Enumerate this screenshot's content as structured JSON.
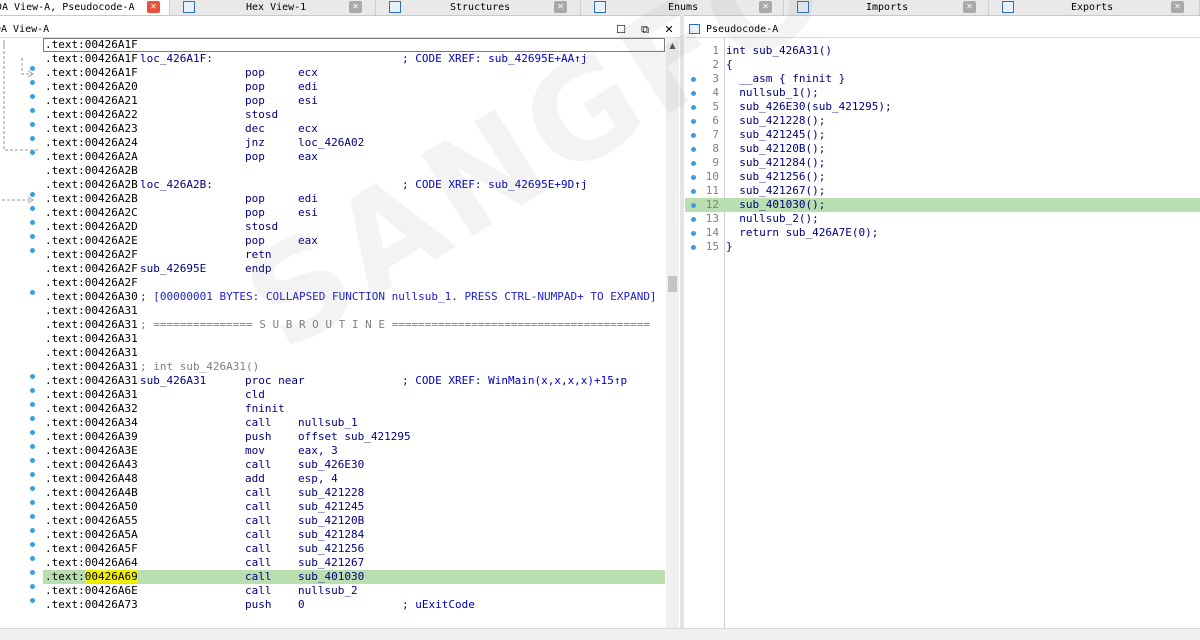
{
  "tabs": [
    {
      "label": "DA View-A, Pseudocode-A",
      "icon": "disasm-icon",
      "active": true
    },
    {
      "label": "Hex View-1",
      "icon": "hex-icon"
    },
    {
      "label": "Structures",
      "icon": "structures-icon"
    },
    {
      "label": "Enums",
      "icon": "enums-icon"
    },
    {
      "label": "Imports",
      "icon": "imports-icon"
    },
    {
      "label": "Exports",
      "icon": "exports-icon"
    }
  ],
  "left_pane": {
    "title": "DA View-A",
    "lines": [
      {
        "addr": "00426A1F"
      },
      {
        "addr": "00426A1F",
        "label": "loc_426A1F:",
        "comment": "; CODE XREF: sub_42695E+AA↑j"
      },
      {
        "addr": "00426A1F",
        "mn": "pop",
        "op": "ecx",
        "dot": true
      },
      {
        "addr": "00426A20",
        "mn": "pop",
        "op": "edi",
        "dot": true
      },
      {
        "addr": "00426A21",
        "mn": "pop",
        "op": "esi",
        "dot": true
      },
      {
        "addr": "00426A22",
        "mn": "stosd",
        "dot": true
      },
      {
        "addr": "00426A23",
        "mn": "dec",
        "op": "ecx",
        "dot": true
      },
      {
        "addr": "00426A24",
        "mn": "jnz",
        "op": "loc_426A02",
        "dot": true
      },
      {
        "addr": "00426A2A",
        "mn": "pop",
        "op": "eax",
        "dot": true
      },
      {
        "addr": "00426A2B"
      },
      {
        "addr": "00426A2B",
        "label": "loc_426A2B:",
        "comment": "; CODE XREF: sub_42695E+9D↑j"
      },
      {
        "addr": "00426A2B",
        "mn": "pop",
        "op": "edi",
        "dot": true
      },
      {
        "addr": "00426A2C",
        "mn": "pop",
        "op": "esi",
        "dot": true
      },
      {
        "addr": "00426A2D",
        "mn": "stosd",
        "dot": true
      },
      {
        "addr": "00426A2E",
        "mn": "pop",
        "op": "eax",
        "dot": true
      },
      {
        "addr": "00426A2F",
        "mn": "retn",
        "dot": true
      },
      {
        "addr": "00426A2F",
        "label": "sub_42695E",
        "mn": "endp"
      },
      {
        "addr": "00426A2F"
      },
      {
        "addr": "00426A30",
        "blue": "; [00000001 BYTES: COLLAPSED FUNCTION nullsub_1. PRESS CTRL-NUMPAD+ TO EXPAND]",
        "dot": true
      },
      {
        "addr": "00426A31"
      },
      {
        "addr": "00426A31",
        "grey": "; =============== S U B R O U T I N E ======================================="
      },
      {
        "addr": "00426A31"
      },
      {
        "addr": "00426A31"
      },
      {
        "addr": "00426A31",
        "grey": "; int sub_426A31()"
      },
      {
        "addr": "00426A31",
        "label": "sub_426A31",
        "mn": "proc near",
        "comment": "; CODE XREF: WinMain(x,x,x,x)+15↑p",
        "dot": true
      },
      {
        "addr": "00426A31",
        "mn": "cld",
        "dot": true
      },
      {
        "addr": "00426A32",
        "mn": "fninit",
        "dot": true
      },
      {
        "addr": "00426A34",
        "mn": "call",
        "op": "nullsub_1",
        "dot": true
      },
      {
        "addr": "00426A39",
        "mn": "push",
        "op": "offset sub_421295",
        "dot": true
      },
      {
        "addr": "00426A3E",
        "mn": "mov",
        "op": "eax, 3",
        "dot": true
      },
      {
        "addr": "00426A43",
        "mn": "call",
        "op": "sub_426E30",
        "dot": true
      },
      {
        "addr": "00426A48",
        "mn": "add",
        "op": "esp, 4",
        "dot": true
      },
      {
        "addr": "00426A4B",
        "mn": "call",
        "op": "sub_421228",
        "dot": true
      },
      {
        "addr": "00426A50",
        "mn": "call",
        "op": "sub_421245",
        "dot": true
      },
      {
        "addr": "00426A55",
        "mn": "call",
        "op": "sub_42120B",
        "dot": true
      },
      {
        "addr": "00426A5A",
        "mn": "call",
        "op": "sub_421284",
        "dot": true
      },
      {
        "addr": "00426A5F",
        "mn": "call",
        "op": "sub_421256",
        "dot": true
      },
      {
        "addr": "00426A64",
        "mn": "call",
        "op": "sub_421267",
        "dot": true
      },
      {
        "addr": "00426A69",
        "mn": "call",
        "op": "sub_401030",
        "dot": true,
        "highlight": true
      },
      {
        "addr": "00426A6E",
        "mn": "call",
        "op": "nullsub_2",
        "dot": true
      },
      {
        "addr": "00426A73",
        "mn": "push",
        "op": "0",
        "comment": "; uExitCode",
        "dot": true
      }
    ]
  },
  "right_pane": {
    "title": "Pseudocode-A",
    "lines": [
      {
        "num": "1",
        "code": "int sub_426A31()"
      },
      {
        "num": "2",
        "code": "{"
      },
      {
        "num": "3",
        "code": "  __asm { fninit }",
        "dot": true
      },
      {
        "num": "4",
        "code": "  nullsub_1();",
        "dot": true
      },
      {
        "num": "5",
        "code": "  sub_426E30(sub_421295);",
        "dot": true
      },
      {
        "num": "6",
        "code": "  sub_421228();",
        "dot": true
      },
      {
        "num": "7",
        "code": "  sub_421245();",
        "dot": true
      },
      {
        "num": "8",
        "code": "  sub_42120B();",
        "dot": true
      },
      {
        "num": "9",
        "code": "  sub_421284();",
        "dot": true
      },
      {
        "num": "10",
        "code": "  sub_421256();",
        "dot": true
      },
      {
        "num": "11",
        "code": "  sub_421267();",
        "dot": true
      },
      {
        "num": "12",
        "code": "  sub_401030();",
        "dot": true,
        "highlight": true
      },
      {
        "num": "13",
        "code": "  nullsub_2();",
        "dot": true
      },
      {
        "num": "14",
        "code": "  return sub_426A7E(0);",
        "dot": true
      },
      {
        "num": "15",
        "code": "}",
        "dot": true
      }
    ]
  },
  "colors": {
    "highlight": "#b9dfb0",
    "accent": "#3c9ee0",
    "active_close": "#e5533c"
  }
}
